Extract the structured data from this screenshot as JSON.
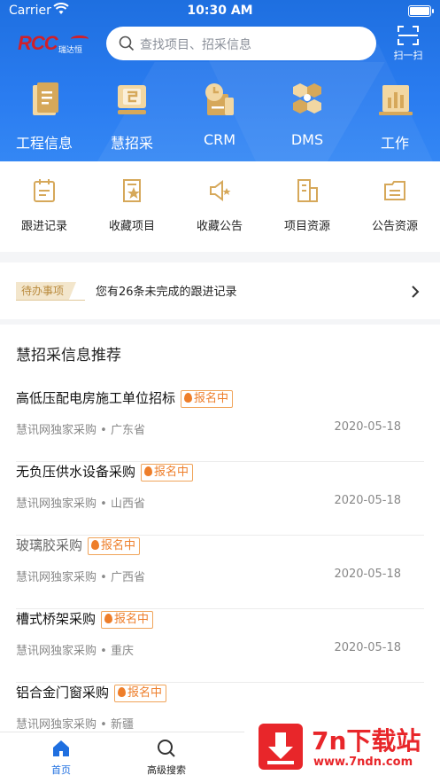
{
  "status": {
    "carrier": "Carrier",
    "time": "10:30 AM"
  },
  "header": {
    "logo_text": "RCC",
    "logo_sub": "瑞达恒",
    "search_placeholder": "查找项目、招采信息",
    "scan_label": "扫一扫"
  },
  "top_nav": [
    {
      "label": "工程信息",
      "icon": "document-icon"
    },
    {
      "label": "慧招采",
      "icon": "monitor-icon"
    },
    {
      "label": "CRM",
      "icon": "clock-card-icon"
    },
    {
      "label": "DMS",
      "icon": "hexagon-network-icon"
    },
    {
      "label": "工作",
      "icon": "chart-board-icon"
    }
  ],
  "quick_actions": [
    {
      "label": "跟进记录",
      "icon": "calendar-icon"
    },
    {
      "label": "收藏项目",
      "icon": "star-document-icon"
    },
    {
      "label": "收藏公告",
      "icon": "megaphone-star-icon"
    },
    {
      "label": "项目资源",
      "icon": "building-icon"
    },
    {
      "label": "公告资源",
      "icon": "folder-icon"
    }
  ],
  "todo": {
    "badge": "待办事项",
    "text": "您有26条未完成的跟进记录"
  },
  "recommend": {
    "title": "慧招采信息推荐",
    "items": [
      {
        "name": "高低压配电房施工单位招标",
        "tag": "报名中",
        "source": "慧讯网独家采购",
        "region": "广东省",
        "date": "2020-05-18"
      },
      {
        "name": "无负压供水设备采购",
        "tag": "报名中",
        "source": "慧讯网独家采购",
        "region": "山西省",
        "date": "2020-05-18"
      },
      {
        "name": "玻璃胶采购",
        "tag": "报名中",
        "source": "慧讯网独家采购",
        "region": "广西省",
        "date": "2020-05-18"
      },
      {
        "name": "槽式桥架采购",
        "tag": "报名中",
        "source": "慧讯网独家采购",
        "region": "重庆",
        "date": "2020-05-18"
      },
      {
        "name": "铝合金门窗采购",
        "tag": "报名中",
        "source": "慧讯网独家采购",
        "region": "新疆",
        "date": ""
      }
    ]
  },
  "tabbar": [
    {
      "label": "首页",
      "active": true
    },
    {
      "label": "高级搜索",
      "active": false
    }
  ],
  "watermark": {
    "big": "7n下载站",
    "small": "www.7ndn.com"
  },
  "colors": {
    "primary": "#1f6fe0",
    "accent": "#d6a85a",
    "tag": "#ee7e2a"
  }
}
